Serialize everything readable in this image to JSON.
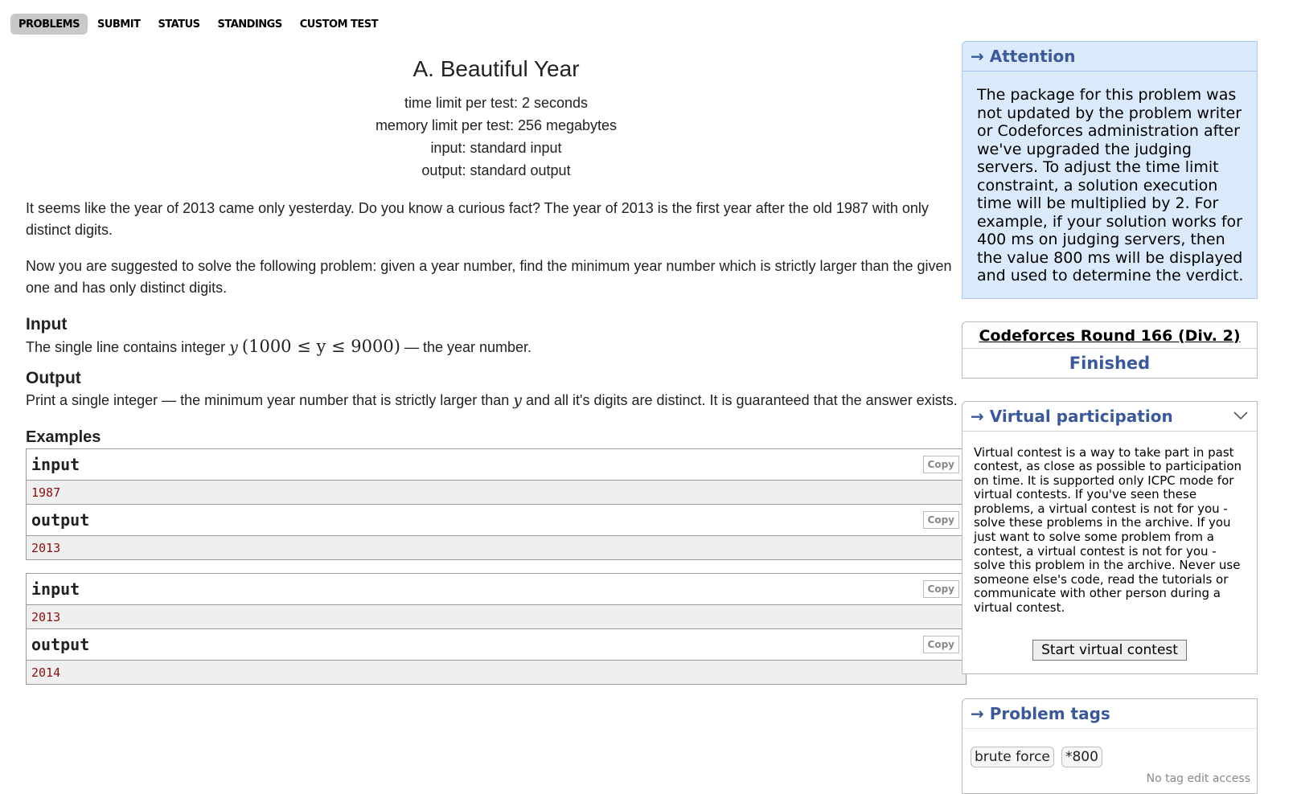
{
  "nav": {
    "tabs": [
      "PROBLEMS",
      "SUBMIT",
      "STATUS",
      "STANDINGS",
      "CUSTOM TEST"
    ],
    "active": 0
  },
  "problem": {
    "title": "A. Beautiful Year",
    "time_limit": "time limit per test: 2 seconds",
    "memory_limit": "memory limit per test: 256 megabytes",
    "input_type": "input: standard input",
    "output_type": "output: standard output",
    "statement_1": "It seems like the year of 2013 came only yesterday. Do you know a curious fact? The year of 2013 is the first year after the old 1987 with only distinct digits.",
    "statement_2": "Now you are suggested to solve the following problem: given a year number, find the minimum year number which is strictly larger than the given one and has only distinct digits.",
    "input_title": "Input",
    "input_pre": "The single line contains integer ",
    "input_var": "y",
    "input_constraint": "(1000 ≤ y ≤ 9000)",
    "input_post": " — the year number.",
    "output_title": "Output",
    "output_pre": "Print a single integer — the minimum year number that is strictly larger than ",
    "output_var": "y",
    "output_post": " and all it's digits are distinct. It is guaranteed that the answer exists.",
    "examples_title": "Examples"
  },
  "examples": [
    {
      "input_label": "input",
      "input": "1987",
      "output_label": "output",
      "output": "2013",
      "copy": "Copy"
    },
    {
      "input_label": "input",
      "input": "2013",
      "output_label": "output",
      "output": "2014",
      "copy": "Copy"
    }
  ],
  "sidebar": {
    "attention_title": "→ Attention",
    "attention_text": "The package for this problem was not updated by the problem writer or Codeforces administration after we've upgraded the judging servers. To adjust the time limit constraint, a solution execution time will be multiplied by 2. For example, if your solution works for 400 ms on judging servers, then the value 800 ms will be displayed and used to determine the verdict.",
    "contest_name": "Codeforces Round 166 (Div. 2)",
    "contest_status": "Finished",
    "vp_title": "→ Virtual participation",
    "vp_text": "Virtual contest is a way to take part in past contest, as close as possible to participation on time. It is supported only ICPC mode for virtual contests. If you've seen these problems, a virtual contest is not for you - solve these problems in the archive. If you just want to solve some problem from a contest, a virtual contest is not for you - solve this problem in the archive. Never use someone else's code, read the tutorials or communicate with other person during a virtual contest.",
    "vp_button": "Start virtual contest",
    "tags_title": "→ Problem tags",
    "tags": [
      "brute force",
      "*800"
    ],
    "no_tag_access": "No tag edit access"
  },
  "icons": {
    "collapse": "chevron-down-icon",
    "arrow": "right-arrow-icon"
  }
}
